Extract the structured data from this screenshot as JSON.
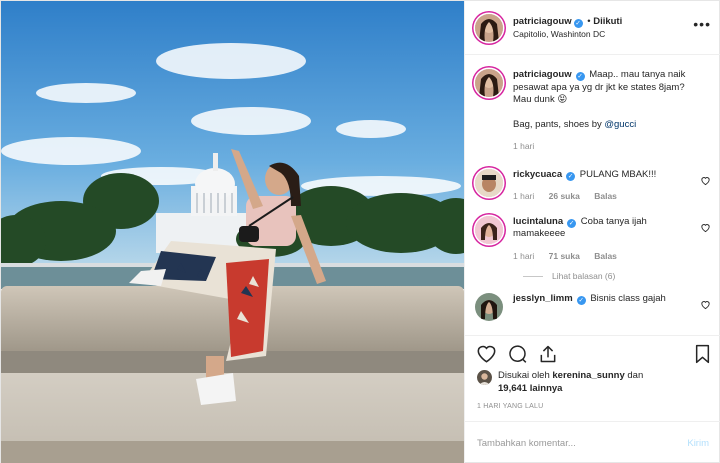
{
  "post": {
    "author": "patriciagouw",
    "follow_label": "Diikuti",
    "location": "Capitolio, Washinton DC",
    "more_icon": "more-dots-icon"
  },
  "caption": {
    "author": "patriciagouw",
    "text": "Maap.. mau tanya naik pesawat apa ya yg dr jkt ke states 8jam? Mau dunk",
    "emoji": "😝",
    "line2_prefix": "Bag, pants, shoes by ",
    "mention": "@gucci",
    "time": "1 hari"
  },
  "comments": [
    {
      "author": "rickycuaca",
      "text": "PULANG MBAK!!!",
      "time": "1 hari",
      "likes": "26 suka",
      "reply": "Balas"
    },
    {
      "author": "lucintaluna",
      "text": "Coba tanya ijah mamakeeee",
      "time": "1 hari",
      "likes": "71 suka",
      "reply": "Balas",
      "view_replies": "Lihat balasan (6)"
    },
    {
      "author": "jesslyn_limm",
      "text": "Bisnis class gajah"
    }
  ],
  "likes": {
    "prefix": "Disukai oleh",
    "user": "kerenina_sunny",
    "connector": "dan",
    "count": "19,641",
    "suffix": "lainnya"
  },
  "date": "1 HARI YANG LALU",
  "add_comment": {
    "placeholder": "Tambahkan komentar...",
    "post_label": "Kirim"
  },
  "colors": {
    "verified": "#3897f0",
    "link": "#003569",
    "post_disabled": "#b2dffc"
  }
}
